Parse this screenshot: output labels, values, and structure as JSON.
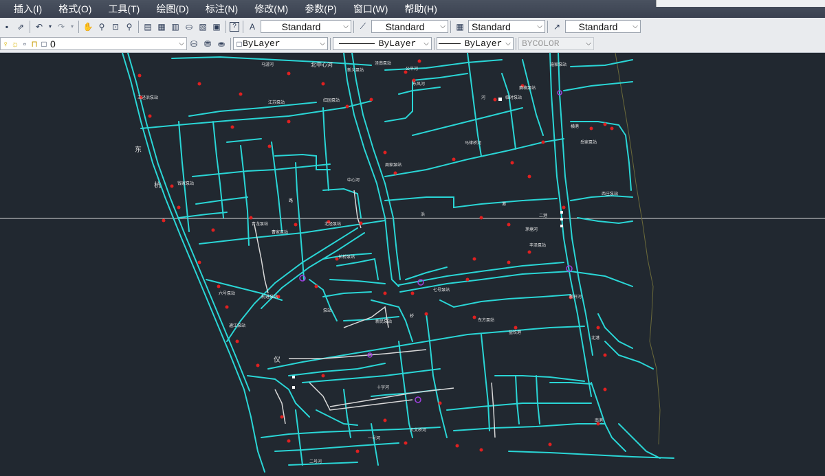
{
  "menu": {
    "items": [
      "插入(I)",
      "格式(O)",
      "工具(T)",
      "绘图(D)",
      "标注(N)",
      "修改(M)",
      "参数(P)",
      "窗口(W)",
      "帮助(H)"
    ]
  },
  "styles_toolbar": {
    "text_style": "Standard",
    "dim_style": "Standard",
    "table_style": "Standard",
    "multileader_style": "Standard"
  },
  "layers_toolbar": {
    "current_layer": "0",
    "color": "ByLayer",
    "linetype": "ByLayer",
    "lineweight": "ByLayer",
    "plot_style": "BYCOLOR"
  },
  "map_labels": [
    "王泾浜泵站",
    "马游河",
    "北中心河",
    "泾南泵站",
    "公平河",
    "新义泵站",
    "江苏泵站",
    "红园泵站",
    "东风河",
    "赛格泵站",
    "临时泵站",
    "施家泵站",
    "马律桥河",
    "二港",
    "横港",
    "岳家泵站",
    "中心河",
    "周家泵站",
    "茅塘河",
    "丰泽泵站",
    "西庄泵站",
    "钱家泵站",
    "曹家泵站",
    "北泾泵站",
    "青龙泵站",
    "长桥泵站",
    "前进泵站",
    "六号泵站",
    "通江泵站",
    "七号泵站",
    "新民泵站",
    "大文桥河",
    "东方泵站",
    "盐铁港",
    "新开河",
    "十字河",
    "仪",
    "东",
    "杭",
    "北港",
    "南港",
    "泵站",
    "一号河",
    "二号河",
    "河",
    "港",
    "浜",
    "路",
    "桥"
  ]
}
